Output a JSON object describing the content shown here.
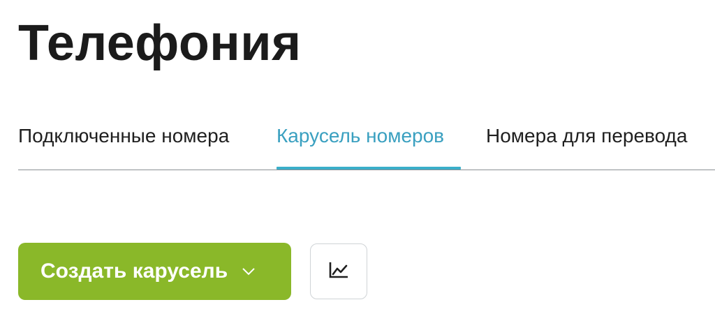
{
  "page": {
    "title": "Телефония"
  },
  "tabs": [
    {
      "label": "Подключенные номера",
      "active": false
    },
    {
      "label": "Карусель номеров",
      "active": true
    },
    {
      "label": "Номера для перевода",
      "active": false
    }
  ],
  "actions": {
    "create_label": "Создать карусель",
    "create_icon": "chevron-down-icon",
    "stats_icon": "line-chart-icon"
  },
  "colors": {
    "accent_tab": "#3aa0c0",
    "button_green": "#8ab829"
  }
}
